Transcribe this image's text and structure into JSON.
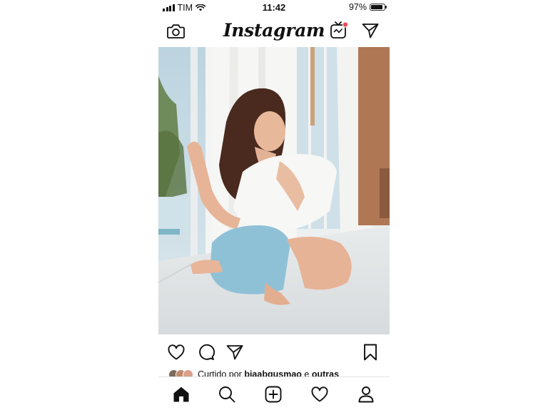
{
  "status_bar": {
    "carrier": "TIM",
    "time": "11:42",
    "battery": "97%"
  },
  "header": {
    "logo": "Instagram",
    "icons": {
      "left": "camera-icon",
      "igtv": "igtv-icon",
      "direct": "direct-message-icon"
    },
    "notification_color": "#ed4956"
  },
  "post": {
    "liked_prefix": "Curtido por",
    "liked_user": "biaabgusmao",
    "liked_join": "e",
    "liked_others": "outras"
  },
  "actions": [
    "heart-icon",
    "comment-icon",
    "share-icon",
    "bookmark-icon"
  ],
  "tab_bar": [
    "home-icon",
    "search-icon",
    "new-post-icon",
    "activity-icon",
    "profile-icon"
  ]
}
